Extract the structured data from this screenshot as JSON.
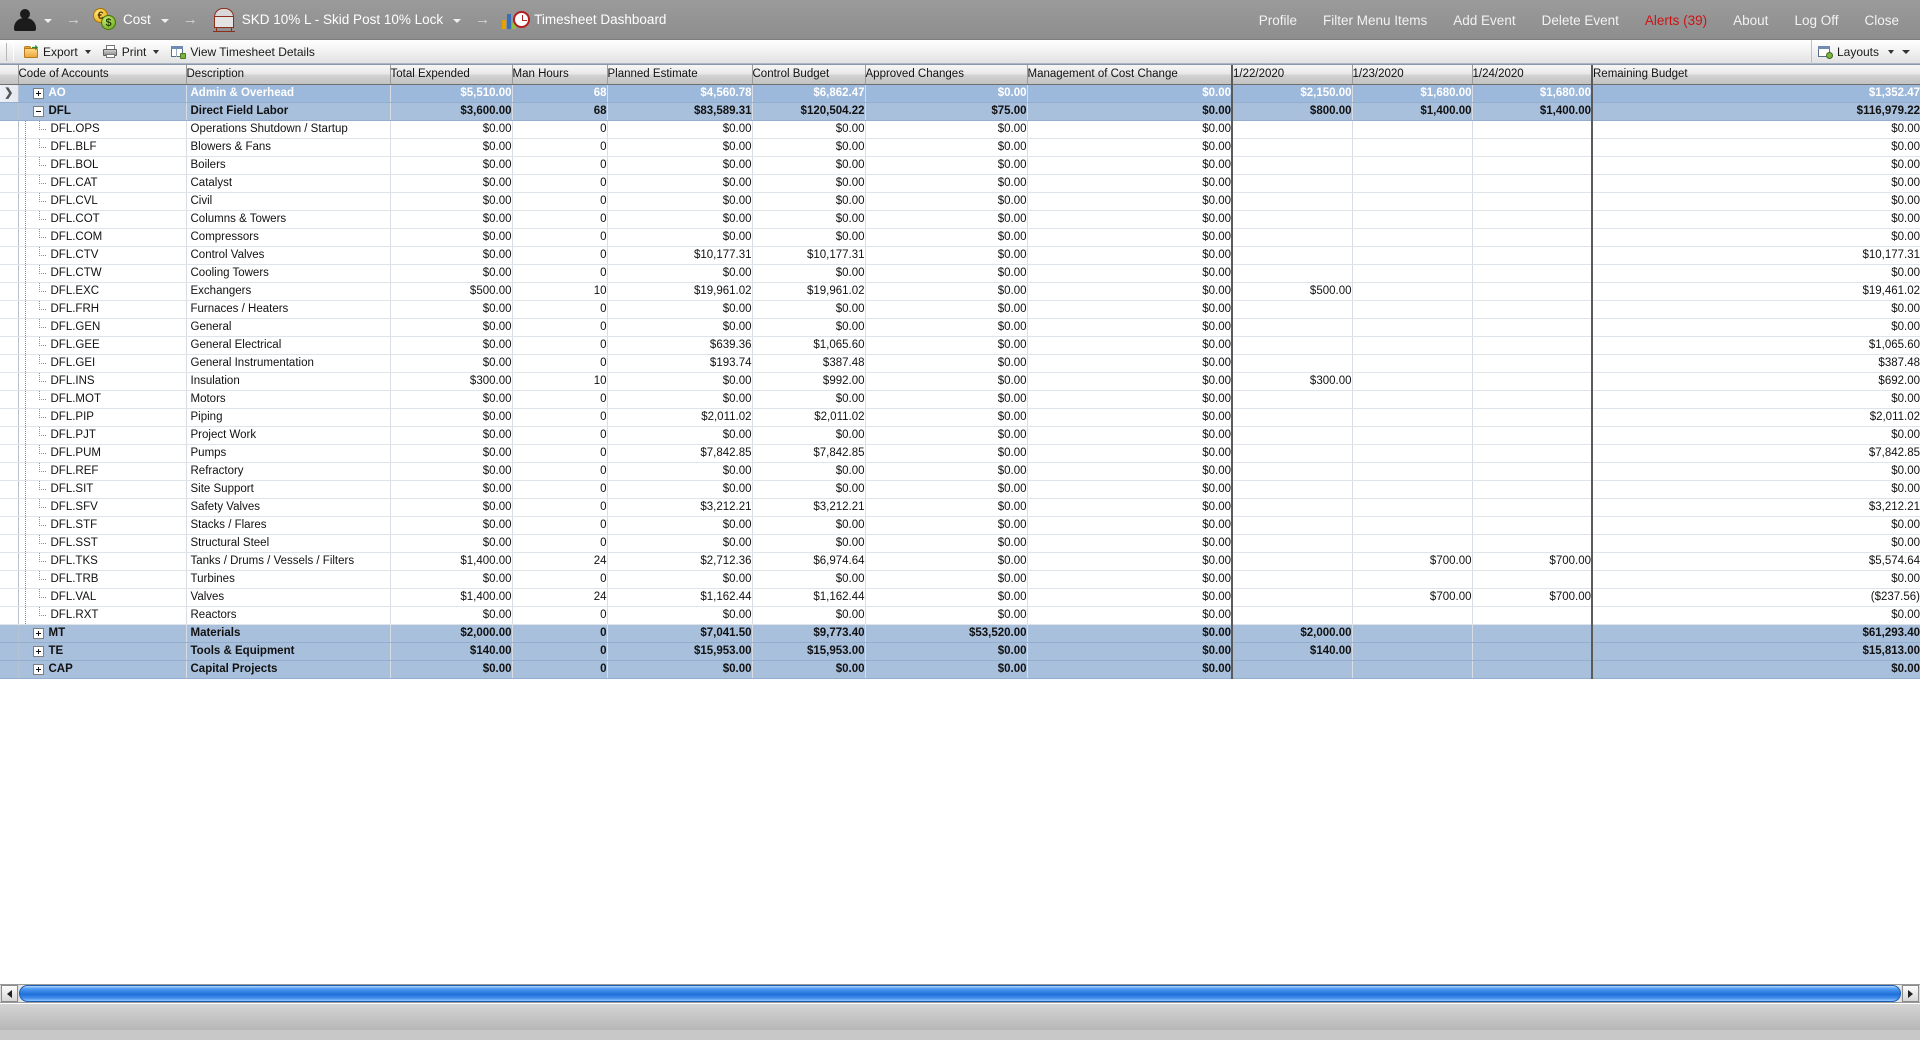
{
  "topbar": {
    "breadcrumbs": [
      {
        "icon": "person-icon",
        "label": "",
        "caret": true,
        "arrow": true
      },
      {
        "icon": "cost-coins-icon",
        "label": "Cost",
        "caret": true,
        "arrow": true
      },
      {
        "icon": "tank-icon",
        "label": "SKD 10% L -  Skid Post 10% Lock",
        "caret": true,
        "arrow": true
      },
      {
        "icon": "dashboard-clock-icon",
        "label": "Timesheet Dashboard",
        "caret": false,
        "arrow": false
      }
    ],
    "menu": [
      {
        "label": "Profile",
        "alert": false
      },
      {
        "label": "Filter Menu Items",
        "alert": false
      },
      {
        "label": "Add Event",
        "alert": false
      },
      {
        "label": "Delete Event",
        "alert": false
      },
      {
        "label": "Alerts (39)",
        "alert": true
      },
      {
        "label": "About",
        "alert": false
      },
      {
        "label": "Log Off",
        "alert": false
      },
      {
        "label": "Close",
        "alert": false
      }
    ],
    "alert_color": "#cc1414"
  },
  "toolbar": {
    "buttons": [
      {
        "icon": "export-icon",
        "label": "Export",
        "caret": true
      },
      {
        "icon": "print-icon",
        "label": "Print",
        "caret": true
      },
      {
        "icon": "grid-details-icon",
        "label": "View Timesheet Details",
        "caret": false
      }
    ],
    "layouts": {
      "icon": "layouts-icon",
      "label": "Layouts",
      "caret": true,
      "dropdown": true
    }
  },
  "grid": {
    "columns": [
      "Code of Accounts",
      "Description",
      "Total Expended",
      "Man Hours",
      "Planned Estimate",
      "Control Budget",
      "Approved Changes",
      "Management of Cost Change",
      "1/22/2020",
      "1/23/2020",
      "1/24/2020",
      "Remaining Budget"
    ],
    "row_pointer": "❯",
    "selected_row_index": 0,
    "rows": [
      {
        "kind": "group",
        "selected": true,
        "expander": "plus",
        "depth": 0,
        "ptr": true,
        "code": "AO",
        "desc": "Admin & Overhead",
        "cells": [
          "$5,510.00",
          "68",
          "$4,560.78",
          "$6,862.47",
          "$0.00",
          "$0.00",
          "$2,150.00",
          "$1,680.00",
          "$1,680.00",
          "$1,352.47"
        ]
      },
      {
        "kind": "group",
        "selected": false,
        "expander": "minus",
        "depth": 0,
        "code": "DFL",
        "desc": "Direct Field Labor",
        "cells": [
          "$3,600.00",
          "68",
          "$83,589.31",
          "$120,504.22",
          "$75.00",
          "$0.00",
          "$800.00",
          "$1,400.00",
          "$1,400.00",
          "$116,979.22"
        ]
      },
      {
        "kind": "detail",
        "depth": 1,
        "code": "DFL.OPS",
        "desc": "Operations Shutdown / Startup",
        "cells": [
          "$0.00",
          "0",
          "$0.00",
          "$0.00",
          "$0.00",
          "$0.00",
          "",
          "",
          "",
          "$0.00"
        ]
      },
      {
        "kind": "detail",
        "depth": 1,
        "code": "DFL.BLF",
        "desc": "Blowers & Fans",
        "cells": [
          "$0.00",
          "0",
          "$0.00",
          "$0.00",
          "$0.00",
          "$0.00",
          "",
          "",
          "",
          "$0.00"
        ]
      },
      {
        "kind": "detail",
        "depth": 1,
        "code": "DFL.BOL",
        "desc": "Boilers",
        "cells": [
          "$0.00",
          "0",
          "$0.00",
          "$0.00",
          "$0.00",
          "$0.00",
          "",
          "",
          "",
          "$0.00"
        ]
      },
      {
        "kind": "detail",
        "depth": 1,
        "code": "DFL.CAT",
        "desc": "Catalyst",
        "cells": [
          "$0.00",
          "0",
          "$0.00",
          "$0.00",
          "$0.00",
          "$0.00",
          "",
          "",
          "",
          "$0.00"
        ]
      },
      {
        "kind": "detail",
        "depth": 1,
        "code": "DFL.CVL",
        "desc": "Civil",
        "cells": [
          "$0.00",
          "0",
          "$0.00",
          "$0.00",
          "$0.00",
          "$0.00",
          "",
          "",
          "",
          "$0.00"
        ]
      },
      {
        "kind": "detail",
        "depth": 1,
        "code": "DFL.COT",
        "desc": "Columns & Towers",
        "cells": [
          "$0.00",
          "0",
          "$0.00",
          "$0.00",
          "$0.00",
          "$0.00",
          "",
          "",
          "",
          "$0.00"
        ]
      },
      {
        "kind": "detail",
        "depth": 1,
        "code": "DFL.COM",
        "desc": "Compressors",
        "cells": [
          "$0.00",
          "0",
          "$0.00",
          "$0.00",
          "$0.00",
          "$0.00",
          "",
          "",
          "",
          "$0.00"
        ]
      },
      {
        "kind": "detail",
        "depth": 1,
        "code": "DFL.CTV",
        "desc": "Control Valves",
        "cells": [
          "$0.00",
          "0",
          "$10,177.31",
          "$10,177.31",
          "$0.00",
          "$0.00",
          "",
          "",
          "",
          "$10,177.31"
        ]
      },
      {
        "kind": "detail",
        "depth": 1,
        "code": "DFL.CTW",
        "desc": "Cooling Towers",
        "cells": [
          "$0.00",
          "0",
          "$0.00",
          "$0.00",
          "$0.00",
          "$0.00",
          "",
          "",
          "",
          "$0.00"
        ]
      },
      {
        "kind": "detail",
        "depth": 1,
        "code": "DFL.EXC",
        "desc": "Exchangers",
        "cells": [
          "$500.00",
          "10",
          "$19,961.02",
          "$19,961.02",
          "$0.00",
          "$0.00",
          "$500.00",
          "",
          "",
          "$19,461.02"
        ]
      },
      {
        "kind": "detail",
        "depth": 1,
        "code": "DFL.FRH",
        "desc": "Furnaces / Heaters",
        "cells": [
          "$0.00",
          "0",
          "$0.00",
          "$0.00",
          "$0.00",
          "$0.00",
          "",
          "",
          "",
          "$0.00"
        ]
      },
      {
        "kind": "detail",
        "depth": 1,
        "code": "DFL.GEN",
        "desc": "General",
        "cells": [
          "$0.00",
          "0",
          "$0.00",
          "$0.00",
          "$0.00",
          "$0.00",
          "",
          "",
          "",
          "$0.00"
        ]
      },
      {
        "kind": "detail",
        "depth": 1,
        "code": "DFL.GEE",
        "desc": "General Electrical",
        "cells": [
          "$0.00",
          "0",
          "$639.36",
          "$1,065.60",
          "$0.00",
          "$0.00",
          "",
          "",
          "",
          "$1,065.60"
        ]
      },
      {
        "kind": "detail",
        "depth": 1,
        "code": "DFL.GEI",
        "desc": "General Instrumentation",
        "cells": [
          "$0.00",
          "0",
          "$193.74",
          "$387.48",
          "$0.00",
          "$0.00",
          "",
          "",
          "",
          "$387.48"
        ]
      },
      {
        "kind": "detail",
        "depth": 1,
        "code": "DFL.INS",
        "desc": "Insulation",
        "cells": [
          "$300.00",
          "10",
          "$0.00",
          "$992.00",
          "$0.00",
          "$0.00",
          "$300.00",
          "",
          "",
          "$692.00"
        ]
      },
      {
        "kind": "detail",
        "depth": 1,
        "code": "DFL.MOT",
        "desc": "Motors",
        "cells": [
          "$0.00",
          "0",
          "$0.00",
          "$0.00",
          "$0.00",
          "$0.00",
          "",
          "",
          "",
          "$0.00"
        ]
      },
      {
        "kind": "detail",
        "depth": 1,
        "code": "DFL.PIP",
        "desc": "Piping",
        "cells": [
          "$0.00",
          "0",
          "$2,011.02",
          "$2,011.02",
          "$0.00",
          "$0.00",
          "",
          "",
          "",
          "$2,011.02"
        ]
      },
      {
        "kind": "detail",
        "depth": 1,
        "code": "DFL.PJT",
        "desc": "Project Work",
        "cells": [
          "$0.00",
          "0",
          "$0.00",
          "$0.00",
          "$0.00",
          "$0.00",
          "",
          "",
          "",
          "$0.00"
        ]
      },
      {
        "kind": "detail",
        "depth": 1,
        "code": "DFL.PUM",
        "desc": "Pumps",
        "cells": [
          "$0.00",
          "0",
          "$7,842.85",
          "$7,842.85",
          "$0.00",
          "$0.00",
          "",
          "",
          "",
          "$7,842.85"
        ]
      },
      {
        "kind": "detail",
        "depth": 1,
        "code": "DFL.REF",
        "desc": "Refractory",
        "cells": [
          "$0.00",
          "0",
          "$0.00",
          "$0.00",
          "$0.00",
          "$0.00",
          "",
          "",
          "",
          "$0.00"
        ]
      },
      {
        "kind": "detail",
        "depth": 1,
        "code": "DFL.SIT",
        "desc": "Site Support",
        "cells": [
          "$0.00",
          "0",
          "$0.00",
          "$0.00",
          "$0.00",
          "$0.00",
          "",
          "",
          "",
          "$0.00"
        ]
      },
      {
        "kind": "detail",
        "depth": 1,
        "code": "DFL.SFV",
        "desc": "Safety Valves",
        "cells": [
          "$0.00",
          "0",
          "$3,212.21",
          "$3,212.21",
          "$0.00",
          "$0.00",
          "",
          "",
          "",
          "$3,212.21"
        ]
      },
      {
        "kind": "detail",
        "depth": 1,
        "code": "DFL.STF",
        "desc": "Stacks / Flares",
        "cells": [
          "$0.00",
          "0",
          "$0.00",
          "$0.00",
          "$0.00",
          "$0.00",
          "",
          "",
          "",
          "$0.00"
        ]
      },
      {
        "kind": "detail",
        "depth": 1,
        "code": "DFL.SST",
        "desc": "Structural Steel",
        "cells": [
          "$0.00",
          "0",
          "$0.00",
          "$0.00",
          "$0.00",
          "$0.00",
          "",
          "",
          "",
          "$0.00"
        ]
      },
      {
        "kind": "detail",
        "depth": 1,
        "code": "DFL.TKS",
        "desc": "Tanks / Drums / Vessels / Filters",
        "cells": [
          "$1,400.00",
          "24",
          "$2,712.36",
          "$6,974.64",
          "$0.00",
          "$0.00",
          "",
          "$700.00",
          "$700.00",
          "$5,574.64"
        ]
      },
      {
        "kind": "detail",
        "depth": 1,
        "code": "DFL.TRB",
        "desc": "Turbines",
        "cells": [
          "$0.00",
          "0",
          "$0.00",
          "$0.00",
          "$0.00",
          "$0.00",
          "",
          "",
          "",
          "$0.00"
        ]
      },
      {
        "kind": "detail",
        "depth": 1,
        "code": "DFL.VAL",
        "desc": "Valves",
        "cells": [
          "$1,400.00",
          "24",
          "$1,162.44",
          "$1,162.44",
          "$0.00",
          "$0.00",
          "",
          "$700.00",
          "$700.00",
          "($237.56)"
        ]
      },
      {
        "kind": "detail",
        "depth": 1,
        "last": true,
        "code": "DFL.RXT",
        "desc": "Reactors",
        "cells": [
          "$0.00",
          "0",
          "$0.00",
          "$0.00",
          "$0.00",
          "$0.00",
          "",
          "",
          "",
          "$0.00"
        ]
      },
      {
        "kind": "group",
        "selected": false,
        "expander": "plus",
        "depth": 0,
        "code": "MT",
        "desc": "Materials",
        "cells": [
          "$2,000.00",
          "0",
          "$7,041.50",
          "$9,773.40",
          "$53,520.00",
          "$0.00",
          "$2,000.00",
          "",
          "",
          "$61,293.40"
        ]
      },
      {
        "kind": "group",
        "selected": false,
        "expander": "plus",
        "depth": 0,
        "code": "TE",
        "desc": "Tools & Equipment",
        "cells": [
          "$140.00",
          "0",
          "$15,953.00",
          "$15,953.00",
          "$0.00",
          "$0.00",
          "$140.00",
          "",
          "",
          "$15,813.00"
        ]
      },
      {
        "kind": "group",
        "selected": false,
        "expander": "plus",
        "depth": 0,
        "code": "CAP",
        "desc": "Capital Projects",
        "cells": [
          "$0.00",
          "0",
          "$0.00",
          "$0.00",
          "$0.00",
          "$0.00",
          "",
          "",
          "",
          "$0.00"
        ]
      }
    ]
  },
  "scrollbar": {
    "left_arrow": "scroll-left-icon",
    "right_arrow": "scroll-right-icon",
    "thumb_percent": 100
  }
}
